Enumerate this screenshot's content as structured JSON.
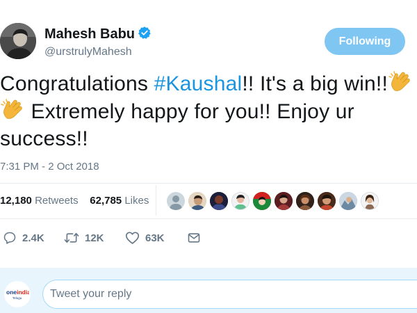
{
  "user": {
    "name": "Mahesh Babu",
    "handle": "@urstrulyMahesh",
    "verified": true,
    "follow_label": "Following"
  },
  "tweet": {
    "text_part1": "Congratulations ",
    "hashtag": "#Kaushal",
    "text_part2": "!! It's a big win!!",
    "text_part3": " Extremely happy for you!! Enjoy ur success!!",
    "emoji": "clapping-hands",
    "timestamp": "7:31 PM - 2 Oct 2018"
  },
  "stats": {
    "retweets_count": "12,180",
    "retweets_label": "Retweets",
    "likes_count": "62,785",
    "likes_label": "Likes",
    "liker_avatar_count": 10
  },
  "actions": {
    "reply_count": "2.4K",
    "retweet_count": "12K",
    "like_count": "63K"
  },
  "reply": {
    "placeholder": "Tweet your reply",
    "avatar_brand": "oneindia",
    "avatar_subtext": "Telugu"
  },
  "colors": {
    "link": "#1b95e0",
    "follow_button": "#7fc6f3",
    "muted": "#657786",
    "reply_bg": "#e8f5fd"
  }
}
